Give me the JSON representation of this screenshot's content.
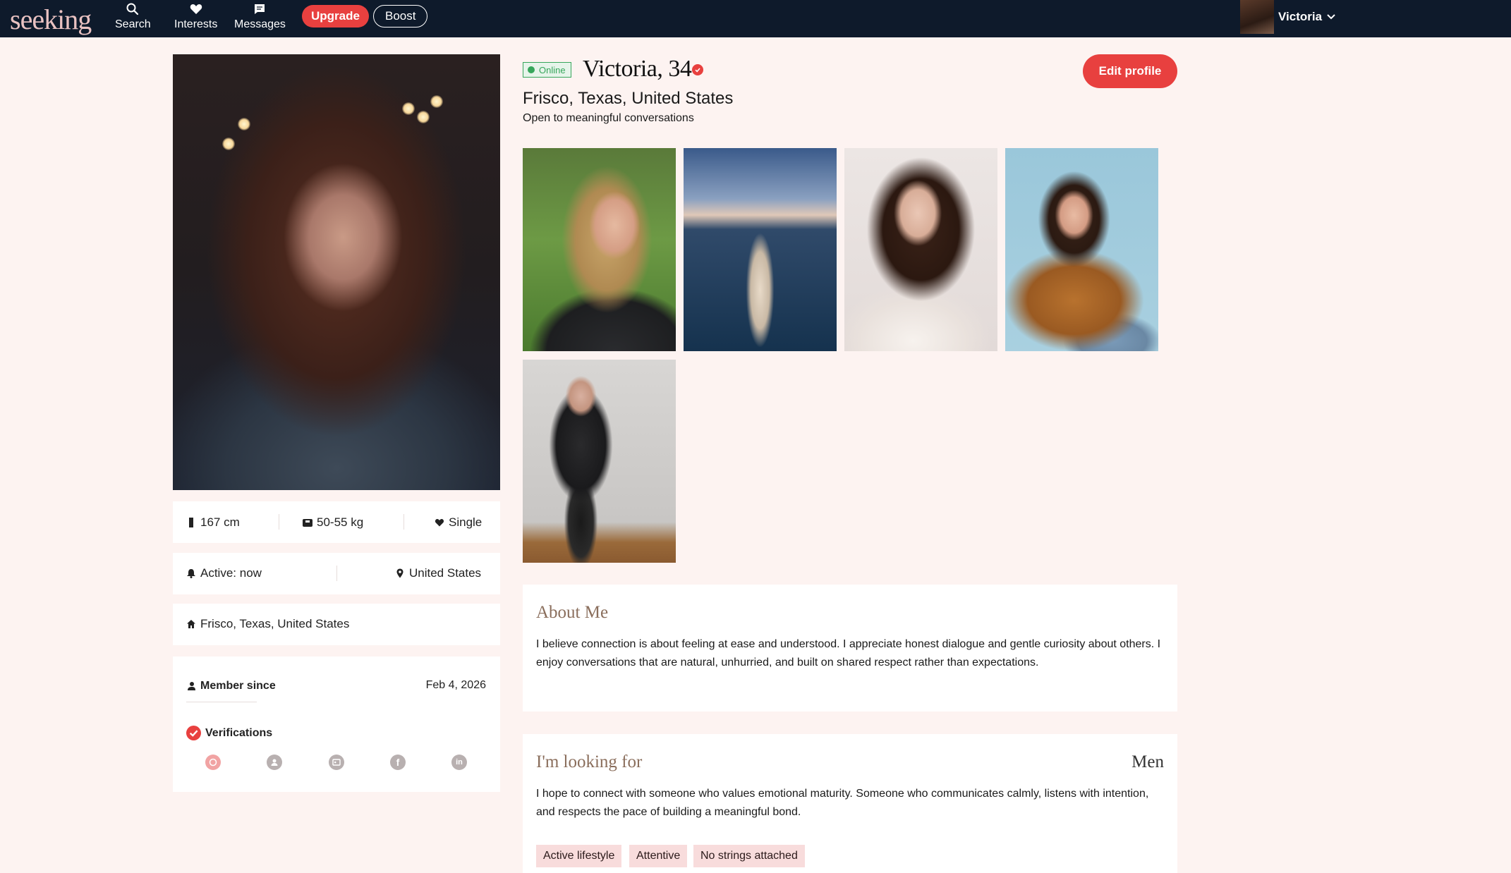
{
  "nav": {
    "logo": "seeking",
    "items": [
      {
        "label": "Search",
        "icon": "search-icon"
      },
      {
        "label": "Interests",
        "icon": "heart-icon"
      },
      {
        "label": "Messages",
        "icon": "message-icon"
      }
    ],
    "upgrade_label": "Upgrade",
    "boost_label": "Boost",
    "user_name": "Victoria"
  },
  "profile": {
    "status": "Online",
    "name_age": "Victoria, 34",
    "location": "Frisco, Texas, United States",
    "tagline": "Open to meaningful conversations",
    "edit_label": "Edit profile"
  },
  "stats": {
    "height": "167 cm",
    "weight": "50-55 kg",
    "relationship": "Single",
    "active": "Active: now",
    "country": "United States",
    "hometown": "Frisco, Texas, United States",
    "member_since_label": "Member since",
    "member_since_value": "Feb 4, 2026",
    "verifications_label": "Verifications",
    "verification_icons": [
      "photo-verify-icon",
      "profile-verify-icon",
      "id-verify-icon",
      "facebook-icon",
      "linkedin-icon"
    ]
  },
  "about": {
    "title": "About Me",
    "body": "I believe connection is about feeling at ease and understood. I appreciate honest dialogue and gentle curiosity about others. I enjoy conversations that are natural, unhurried, and built on shared respect rather than expectations."
  },
  "looking_for": {
    "title": "I'm looking for",
    "target": "Men",
    "body": "I hope to connect with someone who values emotional maturity. Someone who communicates calmly, listens with intention, and respects the pace of building a meaningful bond.",
    "tags": [
      "Active lifestyle",
      "Attentive",
      "No strings attached"
    ]
  },
  "colors": {
    "nav_bg": "#0e1a2b",
    "accent": "#e8403f",
    "page_bg": "#fdf3f1",
    "online": "#37a65b",
    "tag_bg": "#f8dcdc"
  }
}
